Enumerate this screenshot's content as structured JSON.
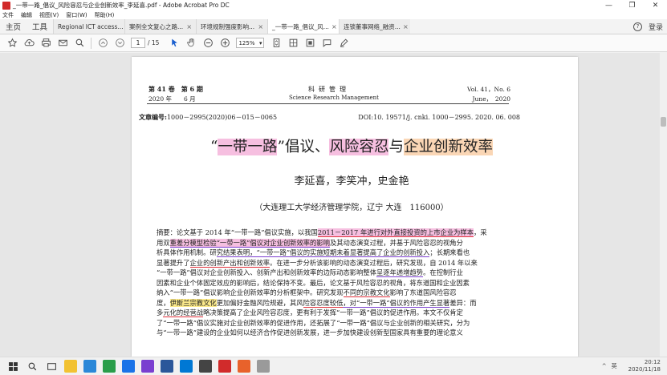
{
  "window": {
    "title": "_一带一路_倡议_风险容忍与企业创新效率_李延喜.pdf - Adobe Acrobat Pro DC",
    "controls": [
      "—",
      "❐",
      "✕"
    ]
  },
  "menu": [
    "文件",
    "编辑",
    "视图(V)",
    "窗口(W)",
    "帮助(H)"
  ],
  "tabs": {
    "home": "主页",
    "tools": "工具",
    "documents": [
      {
        "label": "Regional ICT access...",
        "active": false
      },
      {
        "label": "案例全文复心之路...",
        "active": false
      },
      {
        "label": "环境规制强度影响...",
        "active": false
      },
      {
        "label": "_一带一路_倡议_风...",
        "active": true
      },
      {
        "label": "连锁董事网络_融资...",
        "active": false
      }
    ],
    "close_glyph": "×",
    "help": "?",
    "login": "登录"
  },
  "toolbar": {
    "page_current": "1",
    "page_total": "/ 15",
    "zoom": "125%",
    "zoom_arrow": "▾"
  },
  "pdf": {
    "header_left_1": "第 41 卷　第 6 期",
    "header_left_2": "2020 年　　6 月",
    "header_center_1": "科研管理",
    "header_center_2": "Science Research Management",
    "header_right_1": "Vol. 41，No. 6",
    "header_right_2": "June，　2020",
    "article_no_label": "文章编号:",
    "article_no": "1000－2995(2020)06－015－0065",
    "doi": "DOI:10. 19571/j. cnki. 1000－2995. 2020. 06. 008",
    "title_open": "“",
    "title_part1": "一带一路",
    "title_mid": "”倡议、",
    "title_part2": "风险容忍",
    "title_joiner": "与",
    "title_part3": "企业创新效率",
    "authors": "李延喜，李笑冲，史金艳",
    "affiliation": "（大连理工大学经济管理学院，辽宁 大连　116000）",
    "abstract": {
      "l1_a": "摘要：论文基于 2014 年“一带一路”倡议实施，以我国",
      "l1_b": "2011－2017 年进行对外直接投资的上市企业为样本",
      "l1_c": "，采",
      "l2_a": "用双",
      "l2_b": "重差分模型检验“一带一路”倡议对企业创新效率的影响",
      "l2_c": "及其动态演变过程，并基于风险容忍的视角分",
      "l3_a": "析具体作用机制。研",
      "l3_b": "究结果表明，“一带一路”倡议的实施短期未着显著提高了企业的创新投入",
      "l3_c": "；长期来看也",
      "l4_a": "显著提升了",
      "l4_b": "企业的创新产出和创新效率",
      "l4_c": "。在进一步分析该影响的动态演变过程后，研究发现，自 2014 年以来",
      "l5_a": "“一带一路”倡议对企业创新投入、创新产出和创新效率的边际动态影响整体",
      "l5_b": "呈逐年递增趋势",
      "l5_c": "。在控制行业",
      "l6": "因素和企业个体固定效应的影响后，结论保持不变。最后，论文基于风险容忍的视角，将东道国和企业因素",
      "l7_a": "纳入“一带一路”倡议影响企业创新效率的分析框架中。研究发现",
      "l7_b": "不同的宗教文化",
      "l7_c": "影响了东道国风险容忍",
      "l8_a": "度，",
      "l8_b": "伊斯兰宗教文化",
      "l8_c": "更加偏好金融风险规避，其风",
      "l8_d": "险容忍度较低",
      "l8_e": "，对“一带一路”倡议的作用产生显著",
      "l8_f": "差异：而",
      "l9_a": "多",
      "l9_b": "元化的经营战",
      "l9_c": "略决策提高了企业风险容忍度，更有利于发挥“一带一路”倡议的促进作用。本文不仅肯定",
      "l10": "了“一带一路”倡议实施对企业创新效率的促进作用，还拓展了“一带一路”倡议与企业创新的相关研究，分为",
      "l11": "与“一带一路”建设的企业如何以经济合作促进创新发展，进一步加快建设创新型国家具有重要的理论意义"
    }
  },
  "taskbar": {
    "time": "20:12",
    "date": "2020/11/18",
    "tray_lang": "英",
    "tray_arrow": "^"
  },
  "colors": {
    "highlight_pink": "#f6bfe0",
    "highlight_orange": "#fad6b5",
    "highlight_yellow": "#fbe98a",
    "underline_red": "#e0303a",
    "underline_purple": "#7b3fd0",
    "acrobat_red": "#d12b2b"
  }
}
